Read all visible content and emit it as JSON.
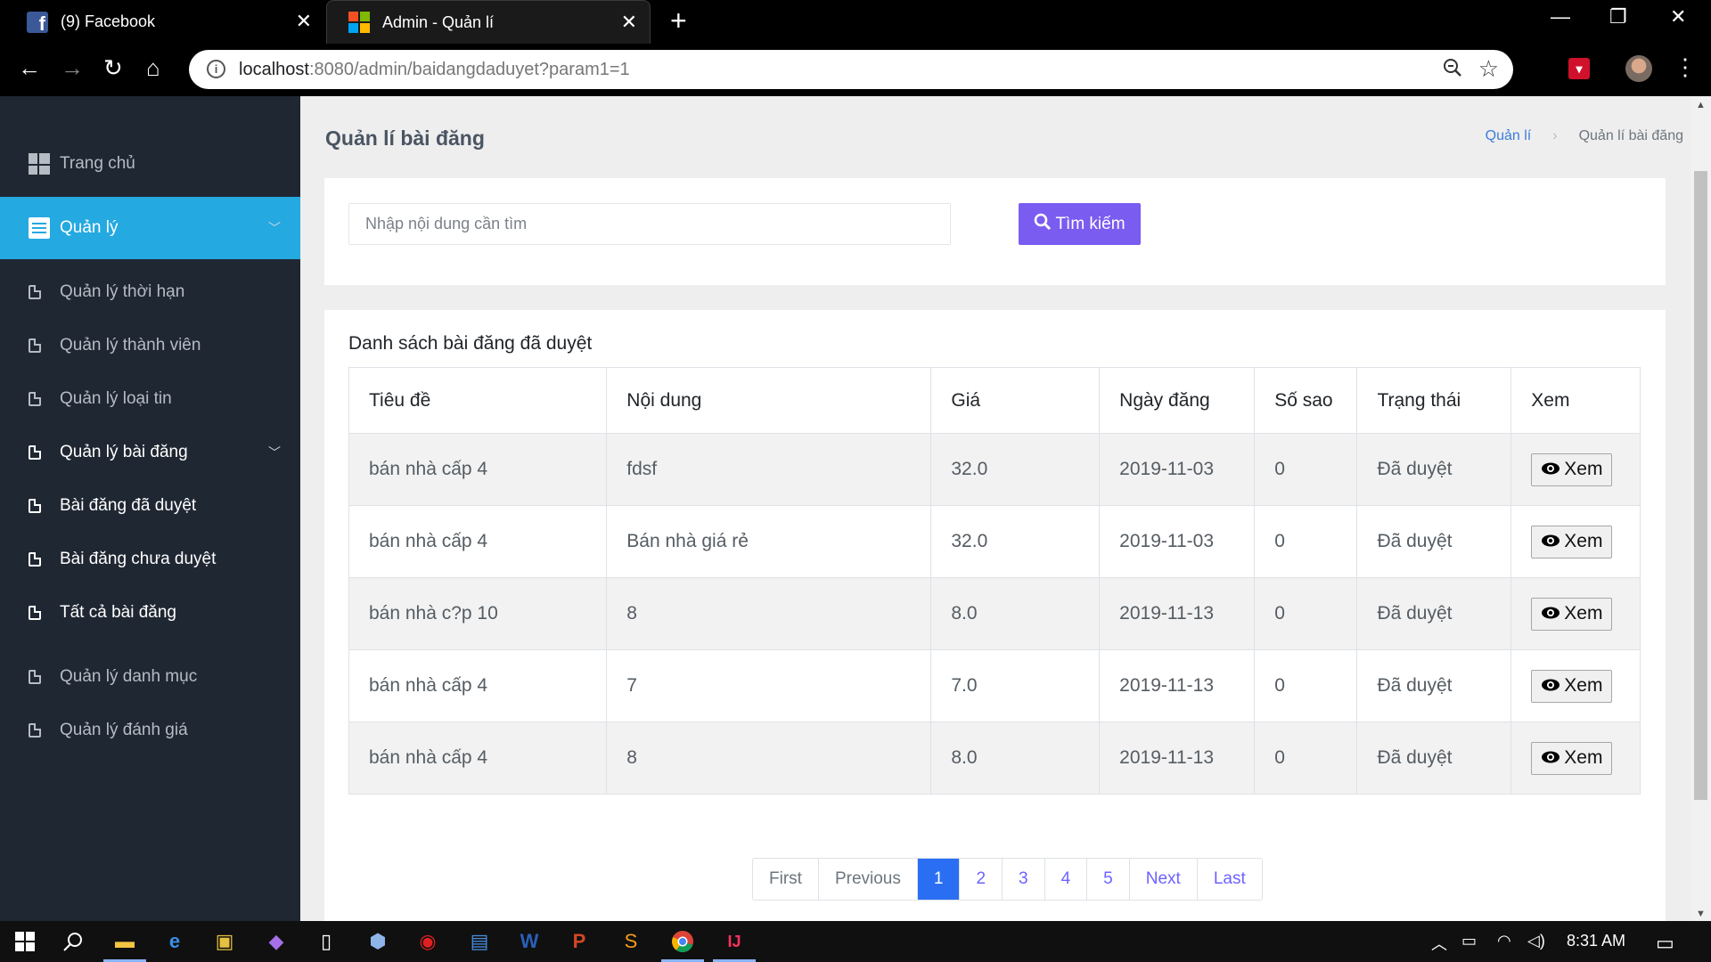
{
  "browser": {
    "tabs": [
      {
        "title": "(9) Facebook",
        "icon": "facebook-icon"
      },
      {
        "title": "Admin - Quản lí",
        "icon": "microsoft-icon"
      }
    ],
    "url_host": "localhost",
    "url_rest": ":8080/admin/baidangdaduyet?param1=1"
  },
  "sidebar": {
    "items": [
      {
        "label": "Trang chủ",
        "icon": "dashboard-icon"
      },
      {
        "label": "Quản lý",
        "icon": "list-icon"
      },
      {
        "label": "Quản lý thời hạn",
        "icon": "document-icon"
      },
      {
        "label": "Quản lý thành viên",
        "icon": "document-icon"
      },
      {
        "label": "Quản lý loại tin",
        "icon": "document-icon"
      },
      {
        "label": "Quản lý bài đăng",
        "icon": "document-icon"
      },
      {
        "label": "Bài đăng đã duyệt",
        "icon": "document-icon"
      },
      {
        "label": "Bài đăng chưa duyệt",
        "icon": "document-icon"
      },
      {
        "label": "Tất cả bài đăng",
        "icon": "document-icon"
      },
      {
        "label": "Quản lý danh mục",
        "icon": "document-icon"
      },
      {
        "label": "Quản lý đánh giá",
        "icon": "document-icon"
      }
    ]
  },
  "header": {
    "title": "Quản lí bài đăng",
    "breadcrumb": [
      "Quản lí",
      "Quản lí bài đăng"
    ]
  },
  "search": {
    "placeholder": "Nhập nội dung cần tìm",
    "button_label": "Tìm kiếm"
  },
  "list": {
    "title": "Danh sách bài đăng đã duyệt",
    "columns": [
      "Tiêu đề",
      "Nội dung",
      "Giá",
      "Ngày đăng",
      "Số sao",
      "Trạng thái",
      "Xem"
    ],
    "rows": [
      [
        "bán nhà cấp 4",
        "fdsf",
        "32.0",
        "2019-11-03",
        "0",
        "Đã duyệt"
      ],
      [
        "bán nhà cấp 4",
        "Bán nhà giá rẻ",
        "32.0",
        "2019-11-03",
        "0",
        "Đã duyệt"
      ],
      [
        "bán nhà c?p 10",
        "8",
        "8.0",
        "2019-11-13",
        "0",
        "Đã duyệt"
      ],
      [
        "bán nhà cấp 4",
        "7",
        "7.0",
        "2019-11-13",
        "0",
        "Đã duyệt"
      ],
      [
        "bán nhà cấp 4",
        "8",
        "8.0",
        "2019-11-13",
        "0",
        "Đã duyệt"
      ]
    ],
    "view_label": "Xem"
  },
  "pagination": {
    "first": "First",
    "previous": "Previous",
    "pages": [
      "1",
      "2",
      "3",
      "4",
      "5"
    ],
    "current": "1",
    "next": "Next",
    "last": "Last"
  },
  "taskbar": {
    "time": "8:31 AM"
  },
  "colors": {
    "sidebar_bg": "#1f2733",
    "sidebar_active": "#24a9e1",
    "search_button": "#7a5cf0",
    "page_active": "#2a6ff3"
  }
}
